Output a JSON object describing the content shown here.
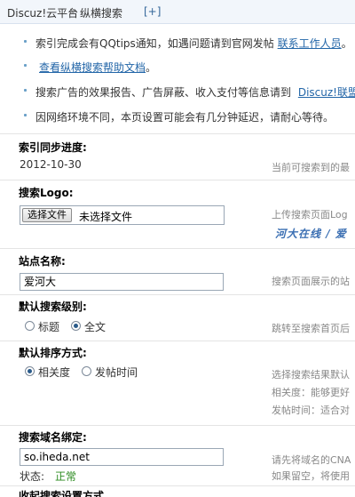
{
  "breadcrumb": {
    "home": "Discuz!云平台",
    "separator": "»",
    "current": "纵横搜索",
    "add_label": "[+]"
  },
  "tips": [
    {
      "text": "索引完成会有QQtips通知，如遇问题请到官网发帖",
      "link": "联系工作人员",
      "suffix": "。"
    },
    {
      "text": "",
      "link": "查看纵横搜索帮助文档",
      "suffix": "。"
    },
    {
      "text": "搜索广告的效果报告、广告屏蔽、收入支付等信息请到",
      "link": "Discuz!联盟",
      "suffix": ""
    },
    {
      "text": "因网络环境不同，本页设置可能会有几分钟延迟，请耐心等待。",
      "link": "",
      "suffix": ""
    }
  ],
  "sections": {
    "sync": {
      "label": "索引同步进度:",
      "value": "2012-10-30",
      "tip": "当前可搜索到的最"
    },
    "logo": {
      "label": "搜索Logo:",
      "button": "选择文件",
      "file_text": "未选择文件",
      "tip": "上传搜索页面Log"
    },
    "site": {
      "label": "站点名称:",
      "value": "爱河大",
      "tip": "搜索页面展示的站"
    },
    "level": {
      "label": "默认搜索级别:",
      "options": [
        "标题",
        "全文"
      ],
      "selected": "全文",
      "tip": "跳转至搜索首页后"
    },
    "order": {
      "label": "默认排序方式:",
      "options": [
        "相关度",
        "发帖时间"
      ],
      "selected": "相关度",
      "tips": [
        "选择搜索结果默认",
        "相关度：能够更好",
        "发帖时间：适合对"
      ]
    },
    "domain": {
      "label": "搜索域名绑定:",
      "value": "so.iheda.net",
      "status_label": "状态:",
      "status_value": "正常",
      "tips": [
        "请先将域名的CNA",
        "如果留空，将使用"
      ]
    }
  },
  "watermark": "河大在线 / 爱",
  "partial_next_label": "收起搜索设置方式"
}
